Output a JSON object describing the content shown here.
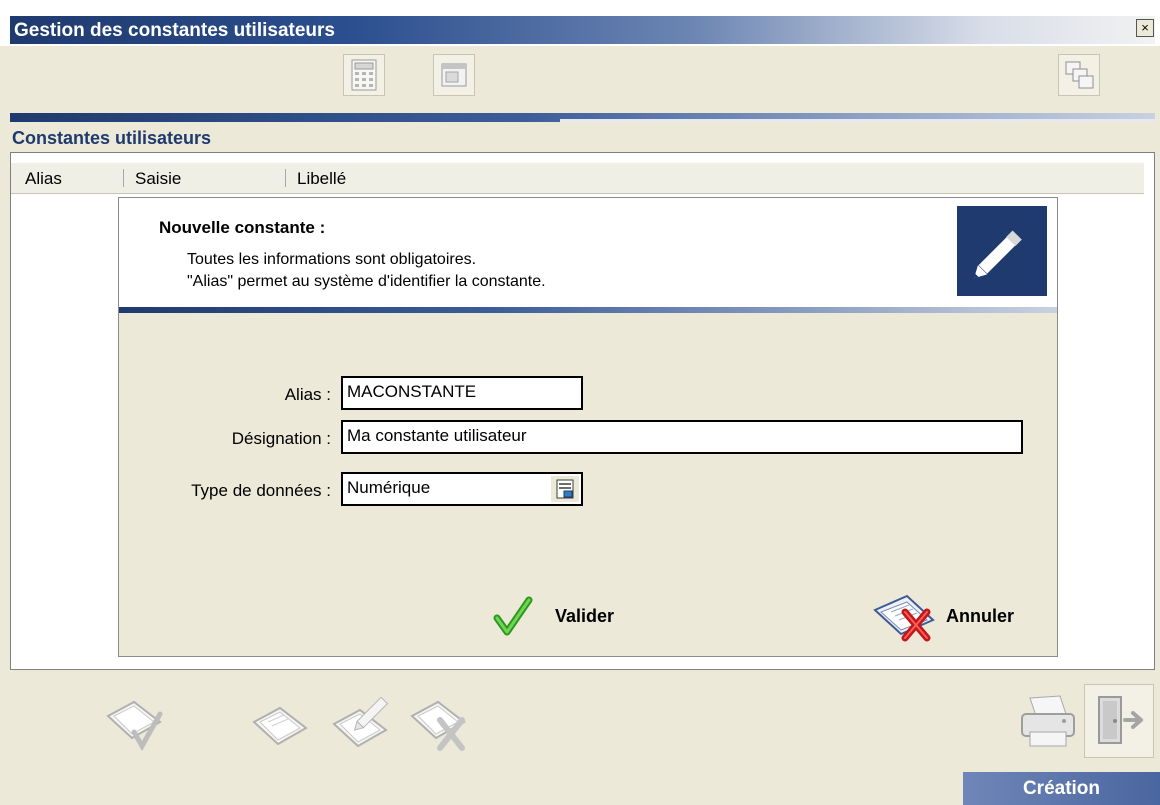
{
  "window": {
    "title": "Gestion des constantes utilisateurs",
    "close_glyph": "×"
  },
  "toolbar": {
    "icons": [
      "calculator-icon",
      "window-icon",
      "windows-cascade-icon"
    ]
  },
  "section": {
    "title": "Constantes utilisateurs"
  },
  "list": {
    "columns": [
      "Alias",
      "Saisie",
      "Libellé"
    ]
  },
  "dialog": {
    "title": "Nouvelle constante :",
    "line1": "Toutes les informations  sont obligatoires.",
    "line2": "\"Alias\" permet au système d'identifier la constante.",
    "fields": {
      "alias_label": "Alias :",
      "alias_value": "MACONSTANTE",
      "designation_label": "Désignation :",
      "designation_value": "Ma constante utilisateur",
      "type_label": "Type de données :",
      "type_value": "Numérique"
    },
    "buttons": {
      "validate": "Valider",
      "cancel": "Annuler"
    }
  },
  "status": {
    "mode": "Création"
  },
  "colors": {
    "accent": "#1f3a6e",
    "status_bg": "#5b74aa",
    "panel": "#ece9d8"
  }
}
